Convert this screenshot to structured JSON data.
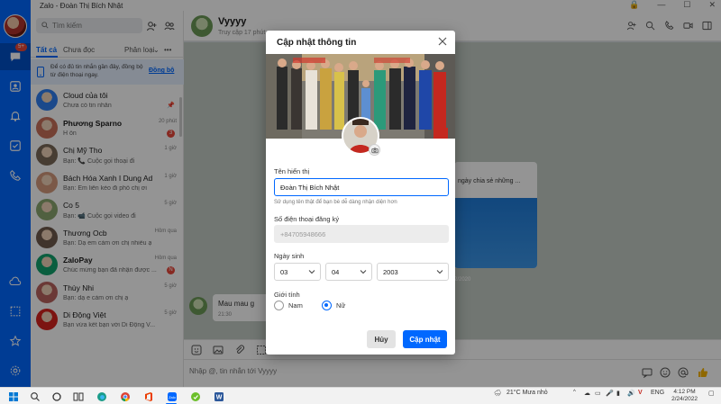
{
  "window": {
    "title": "Zalo - Đoàn Thị Bích Nhật"
  },
  "sidebar": {
    "badge": "5+"
  },
  "conversations": {
    "search_placeholder": "Tìm kiếm",
    "tabs": {
      "all": "Tất cả",
      "unread": "Chưa đọc",
      "classify": "Phân loại",
      "more": "•••"
    },
    "sync_banner": {
      "text": "Để có đủ tin nhắn gần đây, đồng bộ từ điện thoại ngay.",
      "link": "Đồng bộ"
    },
    "items": [
      {
        "name": "Cloud của tôi",
        "preview": "Chưa có tin nhắn",
        "time": "",
        "badge": "",
        "pinned": true,
        "bold": false,
        "avatar_color": "#2f7ef0"
      },
      {
        "name": "Phương Sparno",
        "preview": "H ổn",
        "time": "20 phút",
        "badge": "3",
        "pinned": false,
        "bold": true,
        "avatar_color": "#c9705b"
      },
      {
        "name": "Chị Mỹ Tho",
        "preview": "Bạn: 📞 Cuộc gọi thoại đi",
        "time": "1 giờ",
        "badge": "",
        "pinned": false,
        "bold": false,
        "avatar_color": "#7b6a58"
      },
      {
        "name": "Bách Hóa Xanh I Dung Ad",
        "preview": "Bạn: Em liên kèo đi phố chị ơi",
        "time": "1 giờ",
        "badge": "",
        "pinned": false,
        "bold": false,
        "avatar_color": "#d49a7c"
      },
      {
        "name": "Co 5",
        "preview": "Bạn: 📹 Cuộc gọi video đi",
        "time": "5 giờ",
        "badge": "",
        "pinned": false,
        "bold": false,
        "avatar_color": "#8aa66f"
      },
      {
        "name": "Thương Ocb",
        "preview": "Bạn: Dạ em cảm ơn chị nhiều ạ",
        "time": "Hôm qua",
        "badge": "",
        "pinned": false,
        "bold": false,
        "avatar_color": "#6f5a4c"
      },
      {
        "name": "ZaloPay",
        "preview": "Chúc mừng bạn đã nhận được ...",
        "time": "Hôm qua",
        "badge": "N",
        "pinned": false,
        "bold": true,
        "avatar_color": "#12a36d"
      },
      {
        "name": "Thùy Nhi",
        "preview": "Bạn: dạ e cảm ơn chị ạ",
        "time": "5 giờ",
        "badge": "",
        "pinned": false,
        "bold": false,
        "avatar_color": "#b8625e"
      },
      {
        "name": "Di Động Việt",
        "preview": "Bạn vừa kết bạn với Di Động V...",
        "time": "5 giờ",
        "badge": "",
        "pinned": false,
        "bold": false,
        "avatar_color": "#d6231e"
      }
    ]
  },
  "chat": {
    "name": "Vyyyy",
    "status": "Truy cập 17 phút",
    "card_caption": "ngày chia sẻ những ...",
    "date_divider": "2/2020",
    "message_text": "Mau mau g",
    "message_time": "21:30",
    "composer_placeholder": "Nhập @, tin nhắn tới Vyyyy"
  },
  "modal": {
    "title": "Cập nhật thông tin",
    "display_name_label": "Tên hiển thị",
    "display_name_value": "Đoàn Thị Bích Nhật",
    "display_name_hint": "Sử dụng tên thật để bạn bè dễ dàng nhận diện hơn",
    "phone_label": "Số điện thoại đăng ký",
    "phone_value": "+84705948666",
    "birthday_label": "Ngày sinh",
    "day": "03",
    "month": "04",
    "year": "2003",
    "gender_label": "Giới tính",
    "gender_male": "Nam",
    "gender_female": "Nữ",
    "gender_selected": "female",
    "cancel_label": "Hủy",
    "submit_label": "Cập nhật"
  },
  "taskbar": {
    "weather": "21°C  Mưa nhỏ",
    "language": "ENG",
    "time": "4:12 PM",
    "date": "2/24/2022"
  },
  "colors": {
    "accent": "#0068ff",
    "badge": "#e9473a"
  }
}
